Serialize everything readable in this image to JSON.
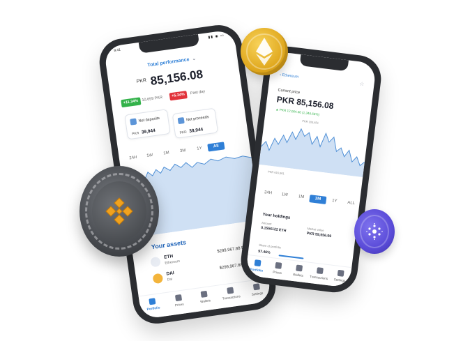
{
  "left_phone": {
    "status_time": "9:41",
    "title": "Total performance",
    "price_currency": "PKR",
    "price_value": "85,156.08",
    "change_up_pct": "+11.34%",
    "change_up_amount": "10,659 PKR",
    "change_down_pct": "+5.34%",
    "change_down_period": "Past day",
    "net_deposits": {
      "label": "Net deposits",
      "currency": "PKR",
      "value": "39,944"
    },
    "net_proceeds": {
      "label": "Net proceeds",
      "currency": "PKR",
      "value": "39,944"
    },
    "timeframes": [
      "24H",
      "1W",
      "1M",
      "3M",
      "1Y",
      "All"
    ],
    "active_timeframe": "All",
    "assets_title": "Your assets",
    "assets": [
      {
        "symbol": "ETH",
        "name": "Ethereum",
        "amount": "$299,967.88 PKR"
      },
      {
        "symbol": "DAI",
        "name": "Dai",
        "amount": "$299,967.88 PKR"
      }
    ],
    "nav": [
      "Portfolio",
      "Prices",
      "Wallets",
      "Transactions",
      "Settings"
    ],
    "active_nav": "Portfolio"
  },
  "right_phone": {
    "back_label": "Ethereum",
    "current_price_label": "Current price",
    "price": "PKR 85,156.08",
    "delta": "PKR 12,064.06 (1,346.66%)",
    "chart_high": "PKR 103,651",
    "chart_low": "PKR 616,901",
    "timeframes": [
      "24H",
      "1W",
      "1M",
      "3M",
      "1Y",
      "ALL"
    ],
    "active_timeframe": "3M",
    "holdings": {
      "title": "Your holdings",
      "amount_label": "Amount",
      "amount_value": "0.1556122 ETH",
      "market_label": "Market value",
      "market_value": "PKR 59,556.59",
      "share_label": "Share of portfolio",
      "share_value": "97.46%"
    },
    "nav": [
      "Portfolio",
      "Prices",
      "Wallets",
      "Transactions",
      "Settings"
    ],
    "active_nav": "Portfolio"
  },
  "colors": {
    "accent": "#2f7fd6",
    "positive": "#33b24a",
    "negative": "#e2343c",
    "chart_fill": "#cfe0f4",
    "chart_line": "#4e8fd6",
    "phone_frame": "#2b2d31",
    "eth_coin": "#e0a81e",
    "bnb_coin": "#4c4f54",
    "bnb_logo": "#f0a21f",
    "ada_coin": "#5a4bd8"
  },
  "icons": {
    "eth_coin": "ethereum-diamond-icon",
    "bnb_coin": "binance-logo-icon",
    "ada_coin": "cardano-dots-icon",
    "favorite": "star-icon",
    "back": "chevron-left-icon"
  }
}
